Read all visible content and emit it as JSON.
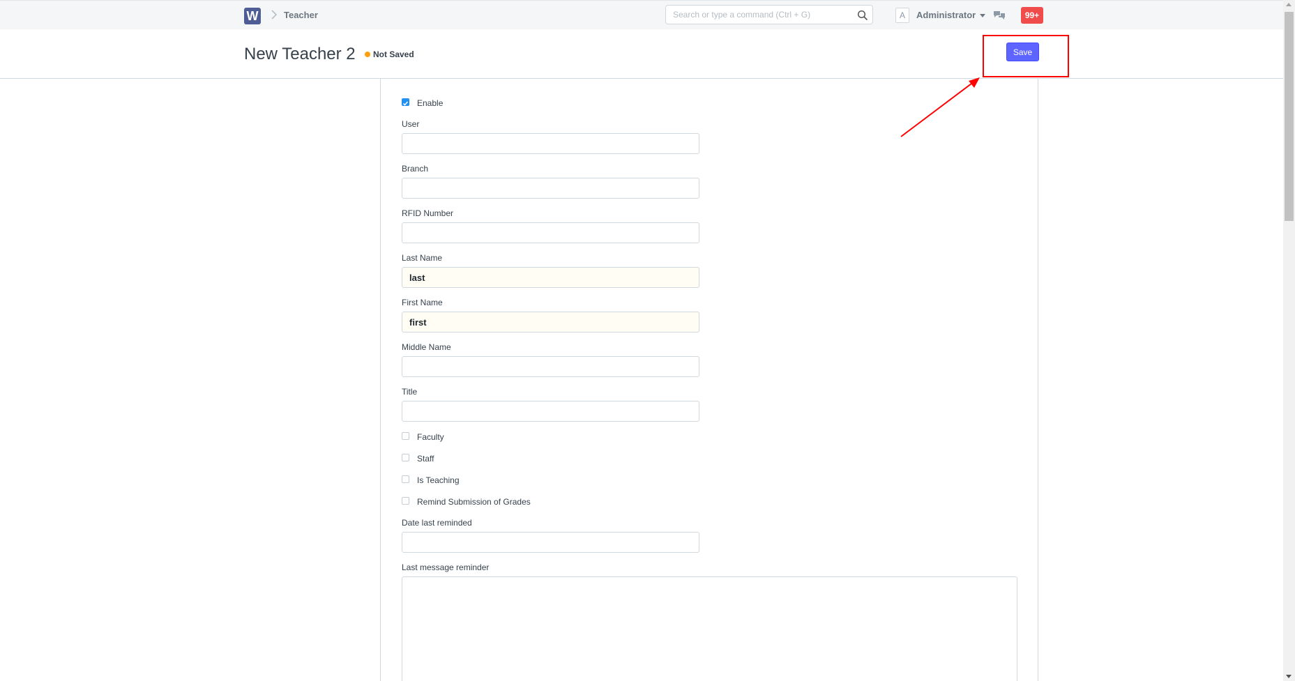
{
  "navbar": {
    "logo_letter": "W",
    "breadcrumb": "Teacher",
    "search_placeholder": "Search or type a command (Ctrl + G)",
    "avatar_letter": "A",
    "user_name": "Administrator",
    "notification_count": "99+"
  },
  "page": {
    "title": "New Teacher 2",
    "status": "Not Saved",
    "save_label": "Save"
  },
  "form": {
    "enable_label": "Enable",
    "enable_checked": true,
    "user_label": "User",
    "user_value": "",
    "branch_label": "Branch",
    "branch_value": "",
    "rfid_label": "RFID Number",
    "rfid_value": "",
    "last_name_label": "Last Name",
    "last_name_value": "last",
    "first_name_label": "First Name",
    "first_name_value": "first",
    "middle_name_label": "Middle Name",
    "middle_name_value": "",
    "title_label": "Title",
    "title_value": "",
    "faculty_label": "Faculty",
    "staff_label": "Staff",
    "is_teaching_label": "Is Teaching",
    "remind_label": "Remind Submission of Grades",
    "date_last_reminded_label": "Date last reminded",
    "date_last_reminded_value": "",
    "last_message_label": "Last message reminder",
    "last_message_value": ""
  },
  "colors": {
    "primary": "#5e64ff",
    "not_saved_dot": "#ffa00a",
    "notification": "#f14c4c",
    "annotation": "#ff0000"
  }
}
